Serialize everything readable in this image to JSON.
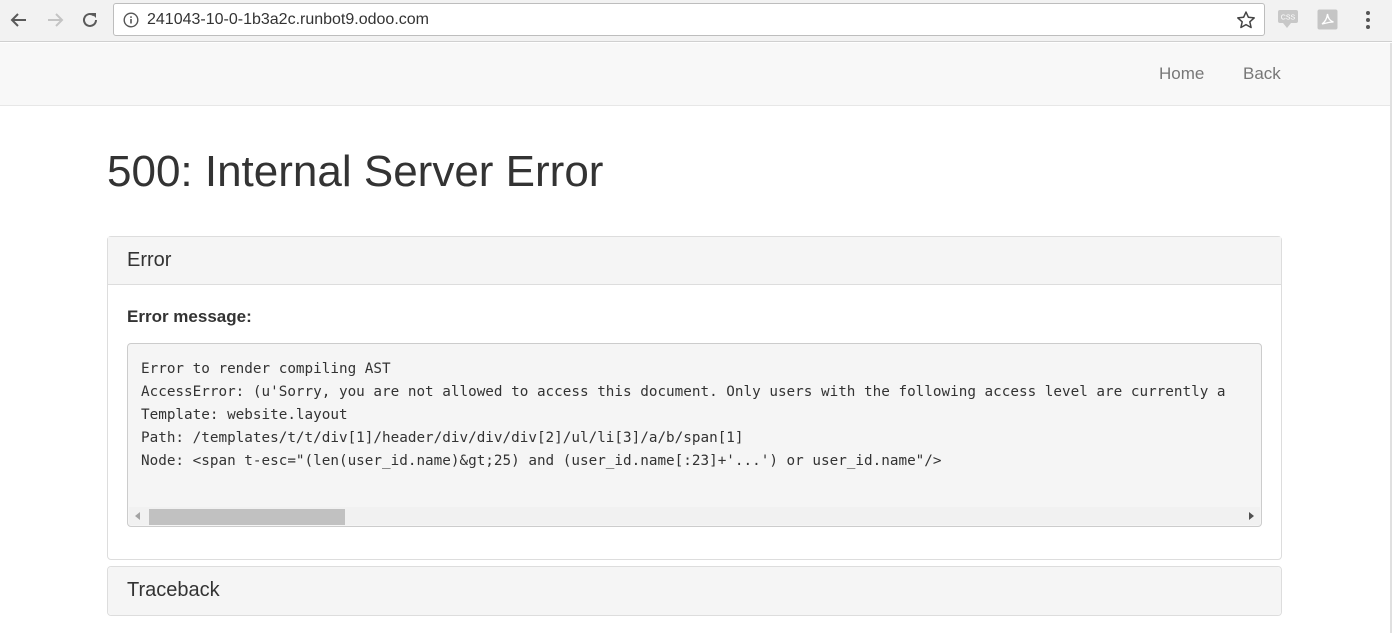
{
  "browser": {
    "url": "241043-10-0-1b3a2c.runbot9.odoo.com",
    "icons": [
      "back-arrow-icon",
      "forward-arrow-icon",
      "reload-icon",
      "info-icon",
      "star-icon",
      "css-extension-icon",
      "pdf-extension-icon",
      "menu-dots-icon"
    ]
  },
  "site_nav": {
    "home_label": "Home",
    "back_label": "Back"
  },
  "page": {
    "title": "500: Internal Server Error"
  },
  "error_panel": {
    "heading": "Error",
    "message_label": "Error message:",
    "lines": [
      "Error to render compiling AST",
      "AccessError: (u'Sorry, you are not allowed to access this document. Only users with the following access level are currently a",
      "Template: website.layout",
      "Path: /templates/t/t/div[1]/header/div/div/div[2]/ul/li[3]/a/b/span[1]",
      "Node: <span t-esc=\"(len(user_id.name)&gt;25) and (user_id.name[:23]+'...') or user_id.name\"/>"
    ]
  },
  "traceback_panel": {
    "heading": "Traceback"
  }
}
